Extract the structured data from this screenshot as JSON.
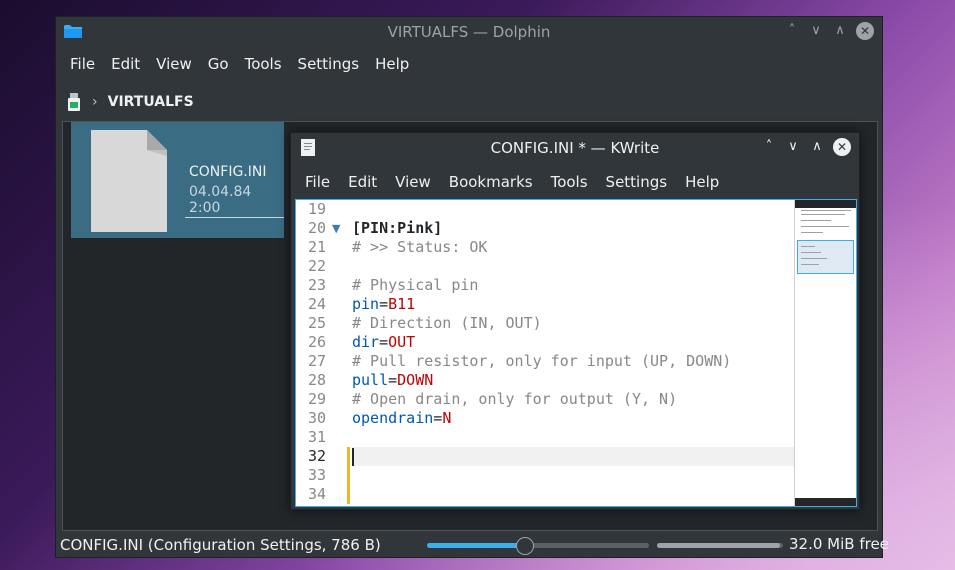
{
  "dolphin": {
    "title": "VIRTUALFS — Dolphin",
    "menu": [
      "File",
      "Edit",
      "View",
      "Go",
      "Tools",
      "Settings",
      "Help"
    ],
    "breadcrumb": "VIRTUALFS",
    "file": {
      "name": "CONFIG.INI",
      "date": "04.04.84 2:00"
    },
    "status": "CONFIG.INI (Configuration Settings, 786 B)",
    "zoom_fraction": 0.44,
    "space_used_fraction": 0.98,
    "free_space": "32.0 MiB free"
  },
  "kwrite": {
    "title": "CONFIG.INI * — KWrite",
    "menu": [
      "File",
      "Edit",
      "View",
      "Bookmarks",
      "Tools",
      "Settings",
      "Help"
    ],
    "lines": [
      {
        "n": "19",
        "parts": []
      },
      {
        "n": "20",
        "parts": [
          {
            "t": "[PIN:Pink]",
            "c": "section"
          }
        ],
        "fold": true
      },
      {
        "n": "21",
        "parts": [
          {
            "t": "# >> Status: OK",
            "c": "comment"
          }
        ]
      },
      {
        "n": "22",
        "parts": []
      },
      {
        "n": "23",
        "parts": [
          {
            "t": "# Physical pin",
            "c": "comment"
          }
        ]
      },
      {
        "n": "24",
        "parts": [
          {
            "t": "pin",
            "c": "key"
          },
          {
            "t": "=",
            "c": "eq"
          },
          {
            "t": "B11",
            "c": "val"
          }
        ]
      },
      {
        "n": "25",
        "parts": [
          {
            "t": "# Direction (IN, OUT)",
            "c": "comment"
          }
        ]
      },
      {
        "n": "26",
        "parts": [
          {
            "t": "dir",
            "c": "key"
          },
          {
            "t": "=",
            "c": "eq"
          },
          {
            "t": "OUT",
            "c": "val"
          }
        ]
      },
      {
        "n": "27",
        "parts": [
          {
            "t": "# Pull resistor, only for input (UP, DOWN)",
            "c": "comment"
          }
        ]
      },
      {
        "n": "28",
        "parts": [
          {
            "t": "pull",
            "c": "key"
          },
          {
            "t": "=",
            "c": "eq"
          },
          {
            "t": "DOWN",
            "c": "val"
          }
        ]
      },
      {
        "n": "29",
        "parts": [
          {
            "t": "# Open drain, only for output (Y, N)",
            "c": "comment"
          }
        ]
      },
      {
        "n": "30",
        "parts": [
          {
            "t": "opendrain",
            "c": "key"
          },
          {
            "t": "=",
            "c": "eq"
          },
          {
            "t": "N",
            "c": "val"
          }
        ]
      },
      {
        "n": "31",
        "parts": []
      },
      {
        "n": "32",
        "parts": [],
        "current": true
      },
      {
        "n": "33",
        "parts": []
      },
      {
        "n": "34",
        "parts": []
      }
    ]
  },
  "icons": {
    "dolphin_app": "folder-icon",
    "device": "usb-drive-icon",
    "file": "document-file-icon",
    "kwrite_app": "text-document-icon"
  },
  "colors": {
    "accent": "#3daee9",
    "selection": "#3a6c84",
    "window_bg": "#31363b"
  }
}
